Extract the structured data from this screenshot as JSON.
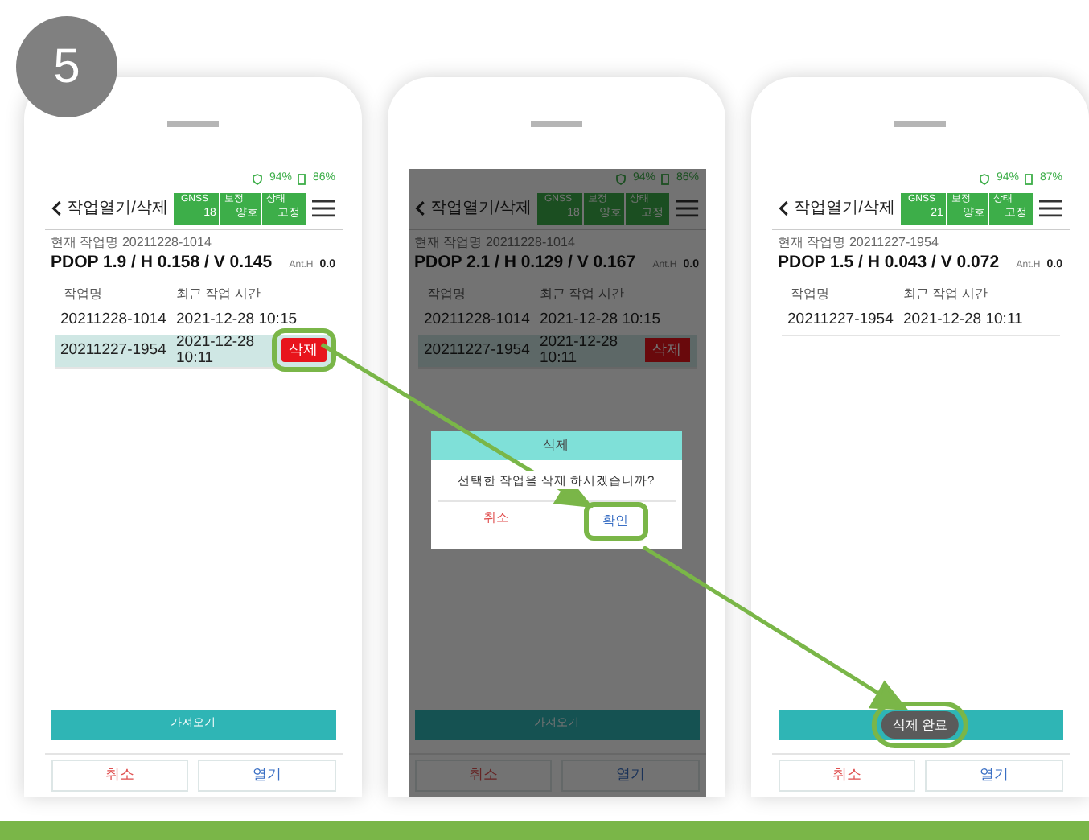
{
  "step": "5",
  "phones": [
    {
      "dimmed": false,
      "signal": "94%",
      "battery": "86%",
      "title": "작업열기/삭제",
      "status": [
        {
          "label": "GNSS",
          "value": "18"
        },
        {
          "label": "보정",
          "value": "양호"
        },
        {
          "label": "상태",
          "value": "고정"
        }
      ],
      "current_job": "현재 작업명 20211228-1014",
      "precision": "PDOP 1.9 / H 0.158 / V 0.145",
      "ant_label": "Ant.H",
      "ant_value": "0.0",
      "columns": [
        "작업명",
        "최근 작업 시간"
      ],
      "rows": [
        {
          "name": "20211228-1014",
          "time": "2021-12-28 10:15",
          "selected": false
        },
        {
          "name": "20211227-1954",
          "time": "2021-12-28 10:11",
          "selected": true,
          "delete": {
            "label": "삭제",
            "highlighted": true
          }
        }
      ],
      "import_button": "가져오기",
      "cancel": "취소",
      "open": "열기"
    },
    {
      "dimmed": true,
      "signal": "94%",
      "battery": "86%",
      "title": "작업열기/삭제",
      "status": [
        {
          "label": "GNSS",
          "value": "18"
        },
        {
          "label": "보정",
          "value": "양호"
        },
        {
          "label": "상태",
          "value": "고정"
        }
      ],
      "current_job": "현재 작업명 20211228-1014",
      "precision": "PDOP 2.1 / H 0.129 / V 0.167",
      "ant_label": "Ant.H",
      "ant_value": "0.0",
      "columns": [
        "작업명",
        "최근 작업 시간"
      ],
      "rows": [
        {
          "name": "20211228-1014",
          "time": "2021-12-28 10:15",
          "selected": false
        },
        {
          "name": "20211227-1954",
          "time": "2021-12-28 10:11",
          "selected": true,
          "delete": {
            "label": "삭제",
            "highlighted": false
          }
        }
      ],
      "import_button": "가져오기",
      "cancel": "취소",
      "open": "열기",
      "dialog": {
        "title": "삭제",
        "message": "선택한 작업을 삭제 하시겠습니까?",
        "cancel": "취소",
        "confirm": "확인",
        "confirm_highlighted": true
      }
    },
    {
      "dimmed": false,
      "signal": "94%",
      "battery": "87%",
      "title": "작업열기/삭제",
      "status": [
        {
          "label": "GNSS",
          "value": "21"
        },
        {
          "label": "보정",
          "value": "양호"
        },
        {
          "label": "상태",
          "value": "고정"
        }
      ],
      "current_job": "현재 작업명 20211227-1954",
      "precision": "PDOP 1.5 / H 0.043 / V 0.072",
      "ant_label": "Ant.H",
      "ant_value": "0.0",
      "columns": [
        "작업명",
        "최근 작업 시간"
      ],
      "rows": [
        {
          "name": "20211227-1954",
          "time": "2021-12-28 10:11",
          "selected": false
        }
      ],
      "cancel": "취소",
      "open": "열기",
      "toast": {
        "text": "삭제 완료",
        "highlighted": true
      }
    }
  ]
}
